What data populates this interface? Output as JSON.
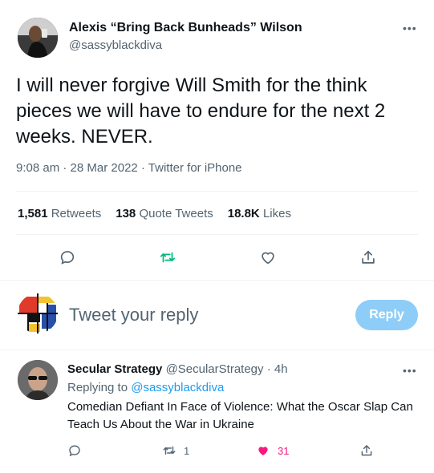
{
  "tweet": {
    "author_name": "Alexis “Bring Back Bunheads” Wilson",
    "author_handle": "@sassyblackdiva",
    "more_label": "•••",
    "text": "I will never forgive Will Smith for the think pieces we will have to endure for the next 2 weeks. NEVER.",
    "meta": "9:08 am · 28 Mar 2022 · Twitter for iPhone",
    "stats": {
      "retweets_count": "1,581",
      "retweets_label": "Retweets",
      "quotes_count": "138",
      "quotes_label": "Quote Tweets",
      "likes_count": "18.8K",
      "likes_label": "Likes"
    },
    "actions": [
      "reply-icon",
      "retweet-icon",
      "like-icon",
      "share-icon"
    ]
  },
  "compose": {
    "placeholder": "Tweet your reply",
    "button_label": "Reply"
  },
  "reply": {
    "author_name": "Secular Strategy",
    "author_handle": "@SecularStrategy",
    "time": "· 4h",
    "more_label": "•••",
    "replying_label": "Replying to",
    "replying_to": "@sassyblackdiva",
    "text": "Comedian Defiant In Face of Violence: What the Oscar Slap Can Teach Us About the War in Ukraine",
    "retweet_count": "1",
    "like_count": "31"
  },
  "colors": {
    "accent": "#1d9bf0",
    "retweet_green": "#00ba7c",
    "like_pink": "#f91880",
    "muted": "#536471",
    "reply_button": "#8ecdf7"
  }
}
